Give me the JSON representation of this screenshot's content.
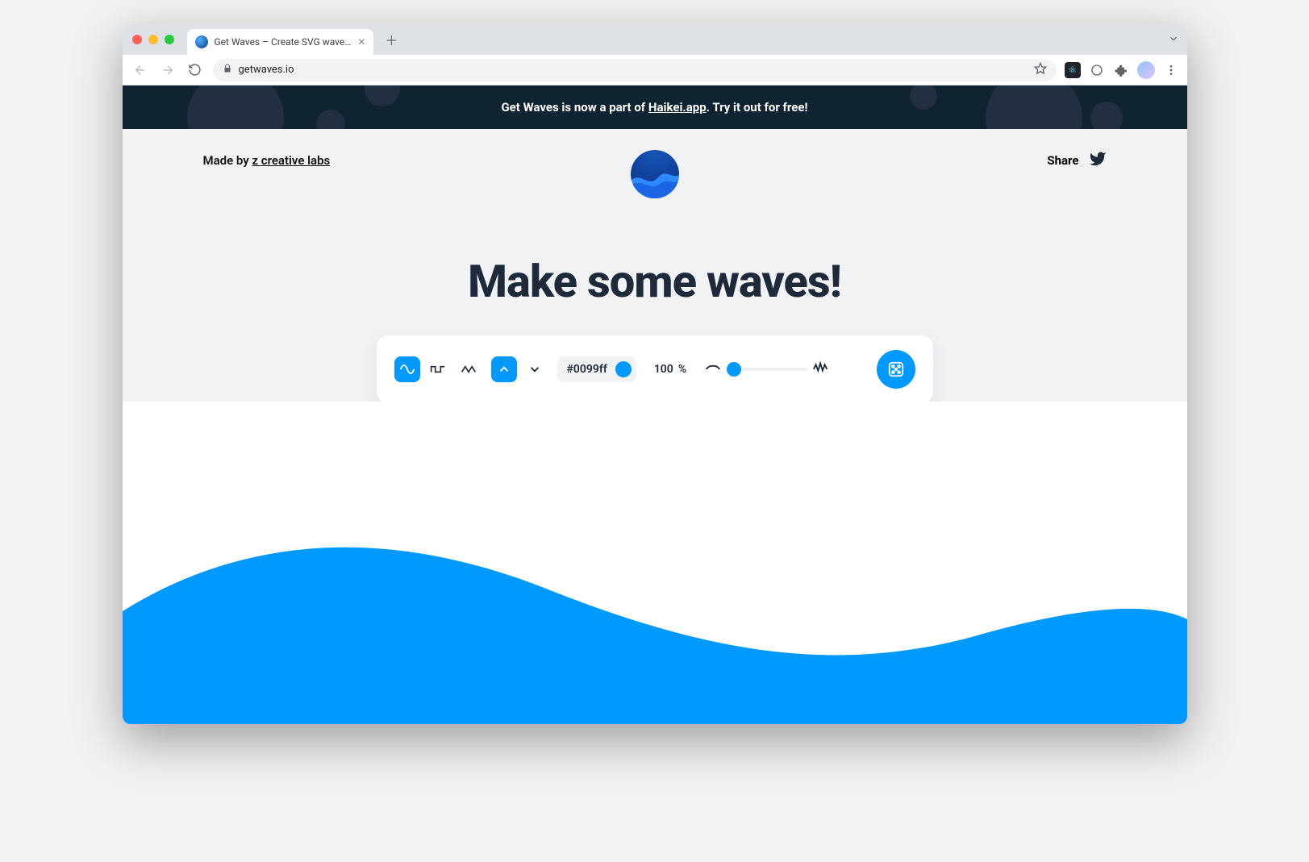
{
  "browser": {
    "tab_title": "Get Waves – Create SVG wave…",
    "url": "getwaves.io"
  },
  "banner": {
    "prefix": "Get Waves is now a part of ",
    "link_text": "Haikei.app",
    "suffix": ". Try it out for free!"
  },
  "header": {
    "madeby_prefix": "Made by ",
    "madeby_link": "z creative labs",
    "share_label": "Share"
  },
  "title": "Make some waves!",
  "controls": {
    "color_hex": "#0099ff",
    "opacity_value": "100",
    "opacity_unit": "%",
    "wave_shape": "sine",
    "direction": "up",
    "complexity": 0
  },
  "icons": {
    "shape_sine": "sine-wave-icon",
    "shape_square": "square-wave-icon",
    "shape_peak": "peak-wave-icon",
    "dir_up": "chevron-up-icon",
    "dir_down": "chevron-down-icon",
    "curve_low": "low-complexity-icon",
    "curve_high": "high-complexity-icon",
    "randomize": "dice-icon",
    "download": "download-cloud-icon",
    "twitter": "twitter-icon"
  }
}
